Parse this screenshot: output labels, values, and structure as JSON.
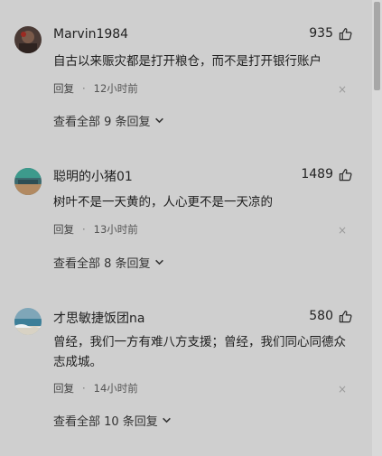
{
  "comments": [
    {
      "username": "Marvin1984",
      "likes": "935",
      "text": "自古以来赈灾都是打开粮仓，而不是打开银行账户",
      "reply_label": "回复",
      "time": "12小时前",
      "view_all": "查看全部 9 条回复"
    },
    {
      "username": "聪明的小猪01",
      "likes": "1489",
      "text": "树叶不是一天黄的，人心更不是一天凉的",
      "reply_label": "回复",
      "time": "13小时前",
      "view_all": "查看全部 8 条回复"
    },
    {
      "username": "才思敏捷饭团na",
      "likes": "580",
      "text": "曾经，我们一方有难八方支援；曾经，我们同心同德众志成城。",
      "reply_label": "回复",
      "time": "14小时前",
      "view_all": "查看全部 10 条回复"
    }
  ],
  "meta_separator": "·",
  "close_glyph": "×",
  "icons": {
    "like": "thumbs-up-icon",
    "chevron": "chevron-down-icon",
    "close": "close-icon"
  },
  "colors": {
    "background": "#cfcfcf",
    "text": "#1f1f1f",
    "muted": "#555555"
  }
}
